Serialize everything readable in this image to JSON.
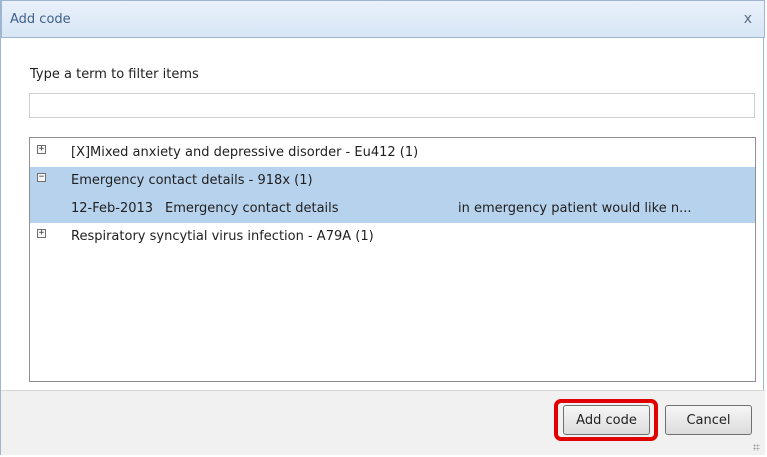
{
  "dialog": {
    "title": "Add code",
    "close_label": "x"
  },
  "filter": {
    "label": "Type a term to filter items",
    "value": "",
    "placeholder": ""
  },
  "tree": {
    "items": [
      {
        "expander": "+",
        "label": "[X]Mixed anxiety and depressive disorder - Eu412 (1)",
        "expanded": false,
        "selected": false
      },
      {
        "expander": "−",
        "label": "Emergency contact details - 918x (1)",
        "expanded": true,
        "selected": true,
        "children": [
          {
            "date": "12-Feb-2013",
            "term": "Emergency contact details",
            "note": "in emergency patient  would like n..."
          }
        ]
      },
      {
        "expander": "+",
        "label": "Respiratory syncytial virus infection - A79A (1)",
        "expanded": false,
        "selected": false
      }
    ]
  },
  "buttons": {
    "add": "Add code",
    "cancel": "Cancel"
  },
  "colors": {
    "selection": "#b7d2ed",
    "highlight": "#e00000",
    "titlebar": "#d7e5f5"
  }
}
